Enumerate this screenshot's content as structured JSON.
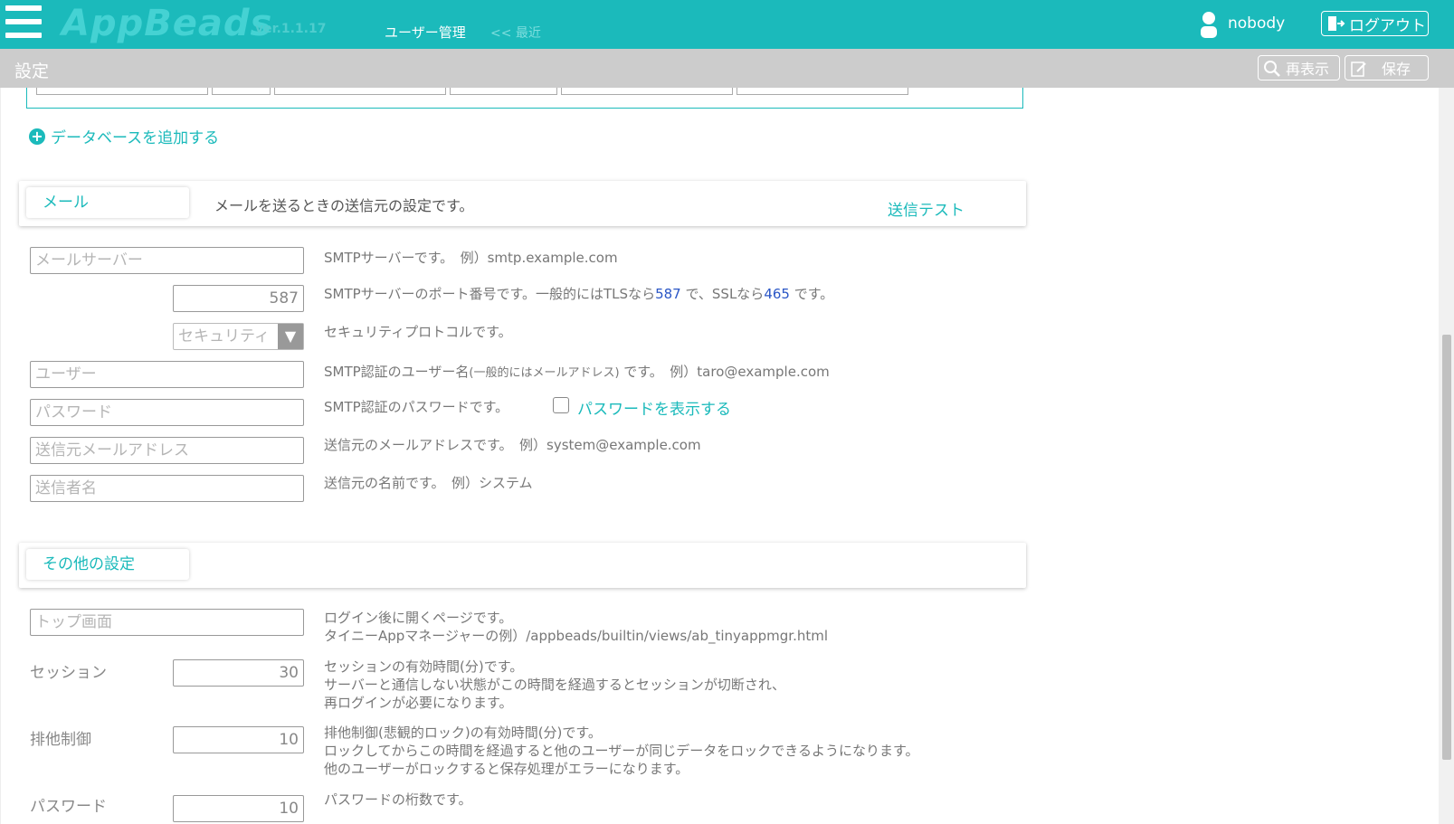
{
  "header": {
    "logo": "AppBeads",
    "version": "ver.1.1.17",
    "nav_user_management": "ユーザー管理",
    "nav_recent": "<< 最近",
    "user_name": "nobody",
    "logout_label": "ログアウト"
  },
  "subbar": {
    "title": "設定",
    "reload_label": "再表示",
    "save_label": "保存"
  },
  "database": {
    "add_label": "データベースを追加する"
  },
  "mail": {
    "tab_label": "メール",
    "description": "メールを送るときの送信元の設定です。",
    "send_test_label": "送信テスト",
    "server": {
      "placeholder": "メールサーバー",
      "desc": "SMTPサーバーです。　例）smtp.example.com"
    },
    "port": {
      "value": "587",
      "desc_1": "SMTPサーバーのポート番号です。一般的にはTLSなら",
      "tls_port": "587",
      "desc_2": "で、SSLなら",
      "ssl_port": "465",
      "desc_3": "です。"
    },
    "security": {
      "placeholder": "セキュリティ",
      "desc": "セキュリティプロトコルです。"
    },
    "user": {
      "placeholder": "ユーザー",
      "desc_1": "SMTP認証のユーザー名",
      "desc_small": "(一般的にはメールアドレス)",
      "desc_2": " です。　例）taro@example.com"
    },
    "password": {
      "placeholder": "パスワード",
      "desc": "SMTP認証のパスワードです。",
      "show_label": "パスワードを表示する"
    },
    "from_address": {
      "placeholder": "送信元メールアドレス",
      "desc": "送信元のメールアドレスです。　例）system@example.com"
    },
    "from_name": {
      "placeholder": "送信者名",
      "desc": "送信元の名前です。　例）システム"
    }
  },
  "other": {
    "tab_label": "その他の設定",
    "top_page": {
      "placeholder": "トップ画面",
      "desc_1": "ログイン後に開くページです。",
      "desc_2": "タイニーAppマネージャーの例）/appbeads/builtin/views/ab_tinyappmgr.html"
    },
    "session": {
      "label": "セッション",
      "value": "30",
      "desc_1": "セッションの有効時間(分)です。",
      "desc_2": "サーバーと通信しない状態がこの時間を経過するとセッションが切断され、",
      "desc_3": "再ログインが必要になります。"
    },
    "lock": {
      "label": "排他制御",
      "value": "10",
      "desc_1": "排他制御(悲観的ロック)の有効時間(分)です。",
      "desc_2": "ロックしてからこの時間を経過すると他のユーザーが同じデータをロックできるようになります。",
      "desc_3": "他のユーザーがロックすると保存処理がエラーになります。"
    },
    "password_len": {
      "label": "パスワード",
      "value": "10",
      "desc_1": "パスワードの桁数です。"
    }
  },
  "colors": {
    "accent": "#1bbabb",
    "subbar": "#cccccc",
    "link_blue": "#2a56c6"
  }
}
